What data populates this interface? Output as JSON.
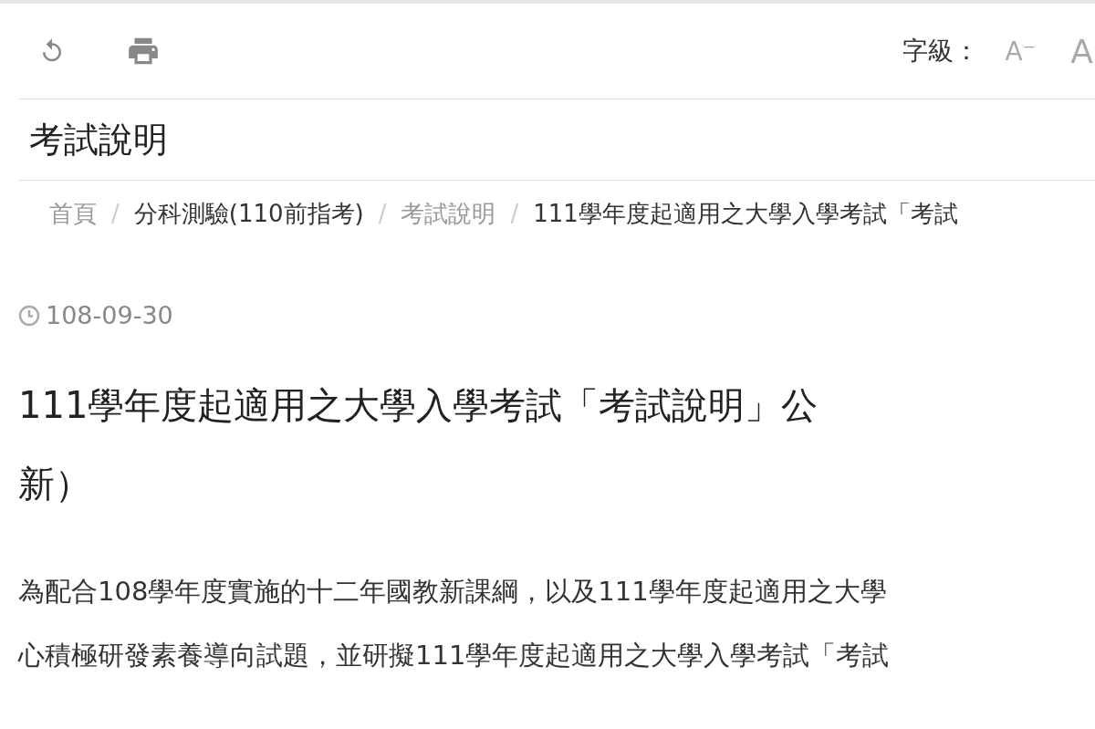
{
  "toolbar": {
    "font_size_label": "字級：",
    "font_buttons": [
      {
        "label": "A⁻",
        "kind": "smaller"
      },
      {
        "label": "A",
        "kind": "larger"
      }
    ]
  },
  "page_title": "考試說明",
  "breadcrumb_separators": [
    "/",
    "/",
    "/"
  ],
  "breadcrumb": [
    {
      "label": "首頁",
      "kind": "muted"
    },
    {
      "label": "分科測驗(110前指考)",
      "kind": "normal"
    },
    {
      "label": "考試說明",
      "kind": "muted"
    },
    {
      "label": "111學年度起適用之大學入學考試「考試",
      "kind": "normal"
    }
  ],
  "article": {
    "date": "108-09-30",
    "heading_lines": [
      "111學年度起適用之大學入學考試「考試說明」公",
      "新）"
    ],
    "body_lines": [
      "為配合108學年度實施的十二年國教新課綱，以及111學年度起適用之大學",
      "心積極研發素養導向試題，並研擬111學年度起適用之大學入學考試「考試"
    ]
  }
}
